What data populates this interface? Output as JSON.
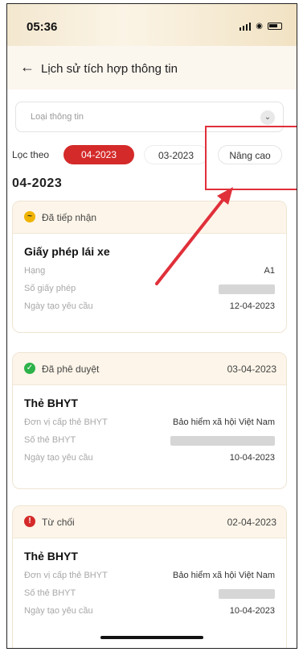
{
  "statusbar": {
    "time": "05:36"
  },
  "header": {
    "title": "Lịch sử tích hợp thông tin"
  },
  "select": {
    "placeholder": "Loại thông tin"
  },
  "filter": {
    "label": "Lọc theo",
    "chips": [
      "04-2023",
      "03-2023",
      "Nâng cao"
    ],
    "active": "04-2023"
  },
  "month_heading": "04-2023",
  "cards": [
    {
      "status": "Đã tiếp nhận",
      "status_color": "#f0b400",
      "date": "",
      "name": "Giấy phép lái xe",
      "rows": [
        {
          "label": "Hạng",
          "value": "A1"
        },
        {
          "label": "Số giấy phép",
          "value": ""
        },
        {
          "label": "Ngày tạo yêu cầu",
          "value": "12-04-2023"
        }
      ]
    },
    {
      "status": "Đã phê duyệt",
      "status_color": "#2db24a",
      "date": "03-04-2023",
      "name": "Thẻ BHYT",
      "rows": [
        {
          "label": "Đơn vị cấp thẻ BHYT",
          "value": "Bảo hiểm xã hội Việt Nam"
        },
        {
          "label": "Số thẻ BHYT",
          "value": ""
        },
        {
          "label": "Ngày tạo yêu cầu",
          "value": "10-04-2023"
        }
      ]
    },
    {
      "status": "Từ chối",
      "status_color": "#d42a2a",
      "date": "02-04-2023",
      "name": "Thẻ BHYT",
      "rows": [
        {
          "label": "Đơn vị cấp thẻ BHYT",
          "value": "Bảo hiểm xã hội Việt Nam"
        },
        {
          "label": "Số thẻ BHYT",
          "value": ""
        },
        {
          "label": "Ngày tạo yêu cầu",
          "value": "10-04-2023"
        }
      ]
    }
  ],
  "colors": {
    "accent": "#d42a2a",
    "annotation": "#e0303a",
    "header_bg": "#fbf6ee"
  }
}
